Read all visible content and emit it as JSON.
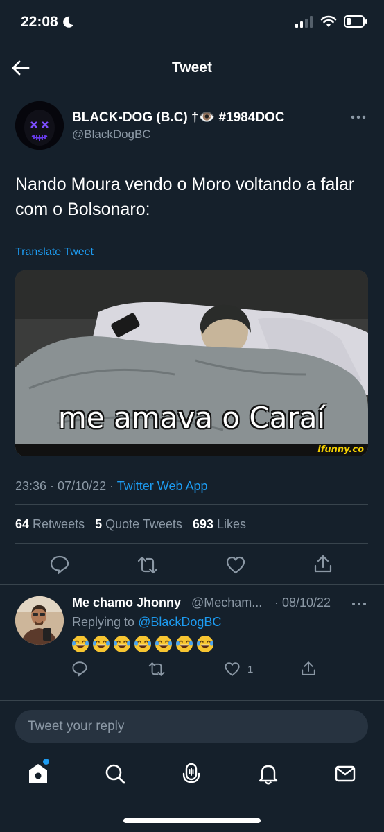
{
  "status_bar": {
    "time": "22:08",
    "moon_icon": "moon-icon",
    "signal_icon": "signal-icon",
    "wifi_icon": "wifi-icon",
    "battery_icon": "battery-icon"
  },
  "header": {
    "back_icon": "arrow-left-icon",
    "title": "Tweet"
  },
  "tweet": {
    "author_name": "BLACK-DOG (B.C) †👁️ #1984DOC",
    "author_handle": "@BlackDogBC",
    "text": "Nando Moura vendo o Moro voltando a falar com o Bolsonaro:",
    "translate_label": "Translate Tweet",
    "media": {
      "caption": "me amava o Caraí",
      "watermark": "ifunny.co"
    },
    "time": "23:36",
    "date": "07/10/22",
    "source": "Twitter Web App",
    "stats": {
      "retweets_count": "64",
      "retweets_label": "Retweets",
      "quotes_count": "5",
      "quotes_label": "Quote Tweets",
      "likes_count": "693",
      "likes_label": "Likes"
    }
  },
  "reply": {
    "name": "Me chamo Jhonny",
    "handle": "@Mecham...",
    "date": "· 08/10/22",
    "replying_prefix": "Replying to",
    "replying_to": "@BlackDogBC",
    "emoji_count": 7,
    "like_count": "1"
  },
  "composer": {
    "placeholder": "Tweet your reply"
  },
  "colors": {
    "background": "#15202b",
    "accent": "#1d9bf0",
    "secondary_text": "#8b98a5",
    "divider": "#38444d"
  }
}
